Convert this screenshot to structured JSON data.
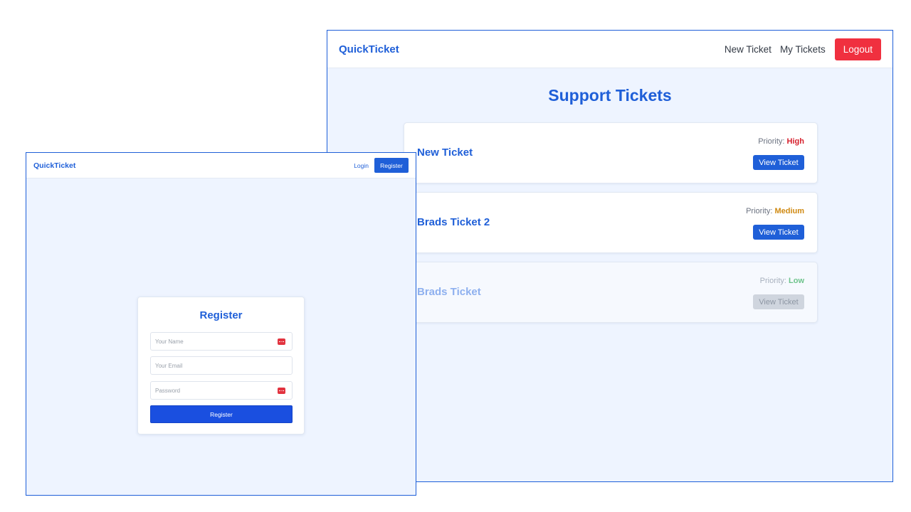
{
  "tickets_window": {
    "brand": "QuickTicket",
    "nav": {
      "new_ticket": "New Ticket",
      "my_tickets": "My Tickets",
      "logout": "Logout"
    },
    "title": "Support Tickets",
    "priority_label": "Priority:",
    "tickets": [
      {
        "title": "New Ticket",
        "priority": "High",
        "priority_color": "#d61f2c",
        "view_label": "View Ticket",
        "disabled": false
      },
      {
        "title": "Brads Ticket 2",
        "priority": "Medium",
        "priority_color": "#d08a12",
        "view_label": "View Ticket",
        "disabled": false
      },
      {
        "title": "Brads Ticket",
        "priority": "Low",
        "priority_color": "#6cc38a",
        "view_label": "View Ticket",
        "disabled": true
      }
    ]
  },
  "register_window": {
    "brand": "QuickTicket",
    "nav": {
      "login": "Login",
      "register": "Register"
    },
    "form": {
      "title": "Register",
      "name_placeholder": "Your Name",
      "email_placeholder": "Your Email",
      "password_placeholder": "Password",
      "submit": "Register"
    }
  },
  "colors": {
    "accent": "#1f5fd8",
    "danger": "#f0303f",
    "page_bg": "#eef4ff"
  }
}
